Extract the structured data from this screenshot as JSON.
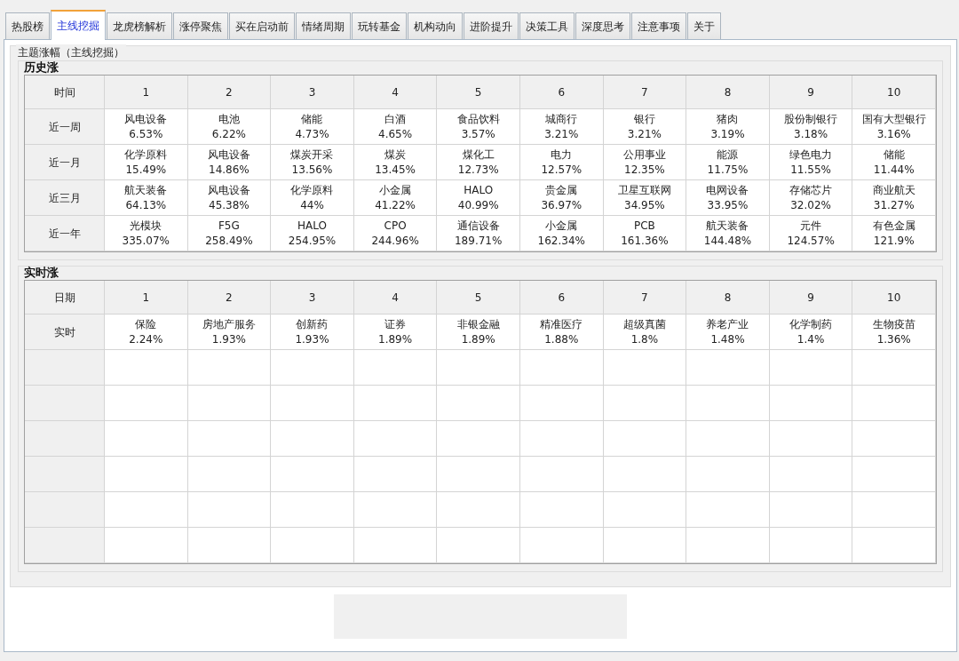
{
  "tabs": [
    {
      "label": "热股榜",
      "selected": false
    },
    {
      "label": "主线挖掘",
      "selected": true
    },
    {
      "label": "龙虎榜解析",
      "selected": false
    },
    {
      "label": "涨停聚焦",
      "selected": false
    },
    {
      "label": "买在启动前",
      "selected": false
    },
    {
      "label": "情绪周期",
      "selected": false
    },
    {
      "label": "玩转基金",
      "selected": false
    },
    {
      "label": "机构动向",
      "selected": false
    },
    {
      "label": "进阶提升",
      "selected": false
    },
    {
      "label": "决策工具",
      "selected": false
    },
    {
      "label": "深度思考",
      "selected": false
    },
    {
      "label": "注意事项",
      "selected": false
    },
    {
      "label": "关于",
      "selected": false
    }
  ],
  "group_title": "主题涨幅（主线挖掘）",
  "sections": [
    {
      "title": "历史涨",
      "corner": "时间",
      "columns": [
        "1",
        "2",
        "3",
        "4",
        "5",
        "6",
        "7",
        "8",
        "9",
        "10"
      ],
      "rows": [
        {
          "label": "近一周",
          "cells": [
            [
              "风电设备",
              "6.53%"
            ],
            [
              "电池",
              "6.22%"
            ],
            [
              "储能",
              "4.73%"
            ],
            [
              "白酒",
              "4.65%"
            ],
            [
              "食品饮料",
              "3.57%"
            ],
            [
              "城商行",
              "3.21%"
            ],
            [
              "银行",
              "3.21%"
            ],
            [
              "猪肉",
              "3.19%"
            ],
            [
              "股份制银行",
              "3.18%"
            ],
            [
              "国有大型银行",
              "3.16%"
            ]
          ]
        },
        {
          "label": "近一月",
          "cells": [
            [
              "化学原料",
              "15.49%"
            ],
            [
              "风电设备",
              "14.86%"
            ],
            [
              "煤炭开采",
              "13.56%"
            ],
            [
              "煤炭",
              "13.45%"
            ],
            [
              "煤化工",
              "12.73%"
            ],
            [
              "电力",
              "12.57%"
            ],
            [
              "公用事业",
              "12.35%"
            ],
            [
              "能源",
              "11.75%"
            ],
            [
              "绿色电力",
              "11.55%"
            ],
            [
              "储能",
              "11.44%"
            ]
          ]
        },
        {
          "label": "近三月",
          "cells": [
            [
              "航天装备",
              "64.13%"
            ],
            [
              "风电设备",
              "45.38%"
            ],
            [
              "化学原料",
              "44%"
            ],
            [
              "小金属",
              "41.22%"
            ],
            [
              "HALO",
              "40.99%"
            ],
            [
              "贵金属",
              "36.97%"
            ],
            [
              "卫星互联网",
              "34.95%"
            ],
            [
              "电网设备",
              "33.95%"
            ],
            [
              "存储芯片",
              "32.02%"
            ],
            [
              "商业航天",
              "31.27%"
            ]
          ]
        },
        {
          "label": "近一年",
          "cells": [
            [
              "光模块",
              "335.07%"
            ],
            [
              "F5G",
              "258.49%"
            ],
            [
              "HALO",
              "254.95%"
            ],
            [
              "CPO",
              "244.96%"
            ],
            [
              "通信设备",
              "189.71%"
            ],
            [
              "小金属",
              "162.34%"
            ],
            [
              "PCB",
              "161.36%"
            ],
            [
              "航天装备",
              "144.48%"
            ],
            [
              "元件",
              "124.57%"
            ],
            [
              "有色金属",
              "121.9%"
            ]
          ]
        }
      ]
    },
    {
      "title": "实时涨",
      "corner": "日期",
      "columns": [
        "1",
        "2",
        "3",
        "4",
        "5",
        "6",
        "7",
        "8",
        "9",
        "10"
      ],
      "rows": [
        {
          "label": "实时",
          "cells": [
            [
              "保险",
              "2.24%"
            ],
            [
              "房地产服务",
              "1.93%"
            ],
            [
              "创新药",
              "1.93%"
            ],
            [
              "证券",
              "1.89%"
            ],
            [
              "非银金融",
              "1.89%"
            ],
            [
              "精准医疗",
              "1.88%"
            ],
            [
              "超级真菌",
              "1.8%"
            ],
            [
              "养老产业",
              "1.48%"
            ],
            [
              "化学制药",
              "1.4%"
            ],
            [
              "生物疫苗",
              "1.36%"
            ]
          ]
        }
      ]
    }
  ]
}
